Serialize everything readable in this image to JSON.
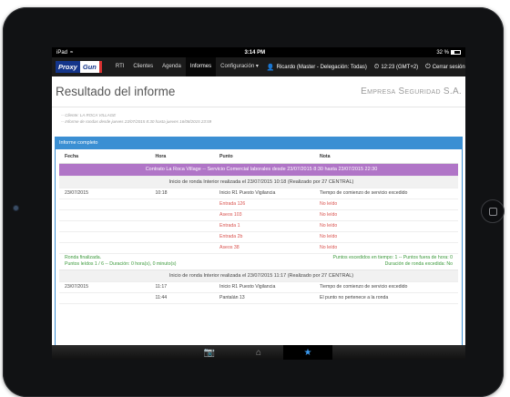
{
  "statusbar": {
    "device": "iPad",
    "time": "3:14 PM",
    "battery": "32 %"
  },
  "navbar": {
    "logo_left": "Proxy",
    "logo_right": "Gun",
    "items": [
      "RTI",
      "Clientes",
      "Agenda",
      "Informes",
      "Configuración"
    ],
    "active_index": 3,
    "user": "Ricardo (Master - Delegación: Todas)",
    "clock": "12:23 (GMT+2)",
    "logout": "Cerrar sesión"
  },
  "page": {
    "title": "Resultado del informe",
    "company": "Empresa Seguridad S.A."
  },
  "meta": {
    "client": "-- Cliente: LA ROCA VILLAGE",
    "range": "-- Informe de rondas desde jueves 23/07/2015 8:30 hasta jueves 16/08/2015 23:59"
  },
  "panel": {
    "title": "Informe completo"
  },
  "table": {
    "headers": {
      "fecha": "Fecha",
      "hora": "Hora",
      "punto": "Punto",
      "nota": "Nota"
    },
    "contract": "Contrato La Roca Village -- Servicio Comercial laborales desde 23/07/2015 8:30 hasta 23/07/2015 22:30",
    "round1_start": "Inicio de ronda Interior realizada el 23/07/2015 10:18 (Realizado por 27 CENTRAL)",
    "round1_rows": [
      {
        "fecha": "23/07/2015",
        "hora": "10:18",
        "punto": "Inicio R1 Puesto Vigilancia",
        "nota": "Tiempo de comienzo de servicio excedido",
        "red": false
      },
      {
        "fecha": "",
        "hora": "",
        "punto": "Entrada 126",
        "nota": "No leído",
        "red": true
      },
      {
        "fecha": "",
        "hora": "",
        "punto": "Aseos 103",
        "nota": "No leído",
        "red": true
      },
      {
        "fecha": "",
        "hora": "",
        "punto": "Entrada 1",
        "nota": "No leído",
        "red": true
      },
      {
        "fecha": "",
        "hora": "",
        "punto": "Entrada 2b",
        "nota": "No leído",
        "red": true
      },
      {
        "fecha": "",
        "hora": "",
        "punto": "Aseos 38",
        "nota": "No leído",
        "red": true
      }
    ],
    "summary": {
      "finished": "Ronda finalizada.",
      "read_points": "Puntos leídos 1 / 6 -- Duración: 0 hora(s), 0 minuto(s)",
      "on_time": "Puntos escedidos en tiempo: 1 -- Puntos fuera de hora: 0",
      "exceeded": "Duración de ronda excedida: No"
    },
    "round2_start": "Inicio de ronda Interior realizada el 23/07/2015 11:17 (Realizado por 27 CENTRAL)",
    "round2_rows": [
      {
        "fecha": "23/07/2015",
        "hora": "11:17",
        "punto": "Inicio R1 Puesto Vigilancia",
        "nota": "Tiempo de comienzo de servicio excedido",
        "red": false
      },
      {
        "fecha": "",
        "hora": "11:44",
        "punto": "Pantalán 13",
        "nota": "El punto no pertenece a la ronda",
        "red": false
      }
    ]
  },
  "tabbar": {
    "icons": [
      "camera-icon",
      "home-icon",
      "star-icon"
    ],
    "active_index": 2
  },
  "colors": {
    "accent": "#3b8fd3",
    "contract": "#b075c7",
    "alert": "#d9534f",
    "ok": "#3c9a3c"
  }
}
